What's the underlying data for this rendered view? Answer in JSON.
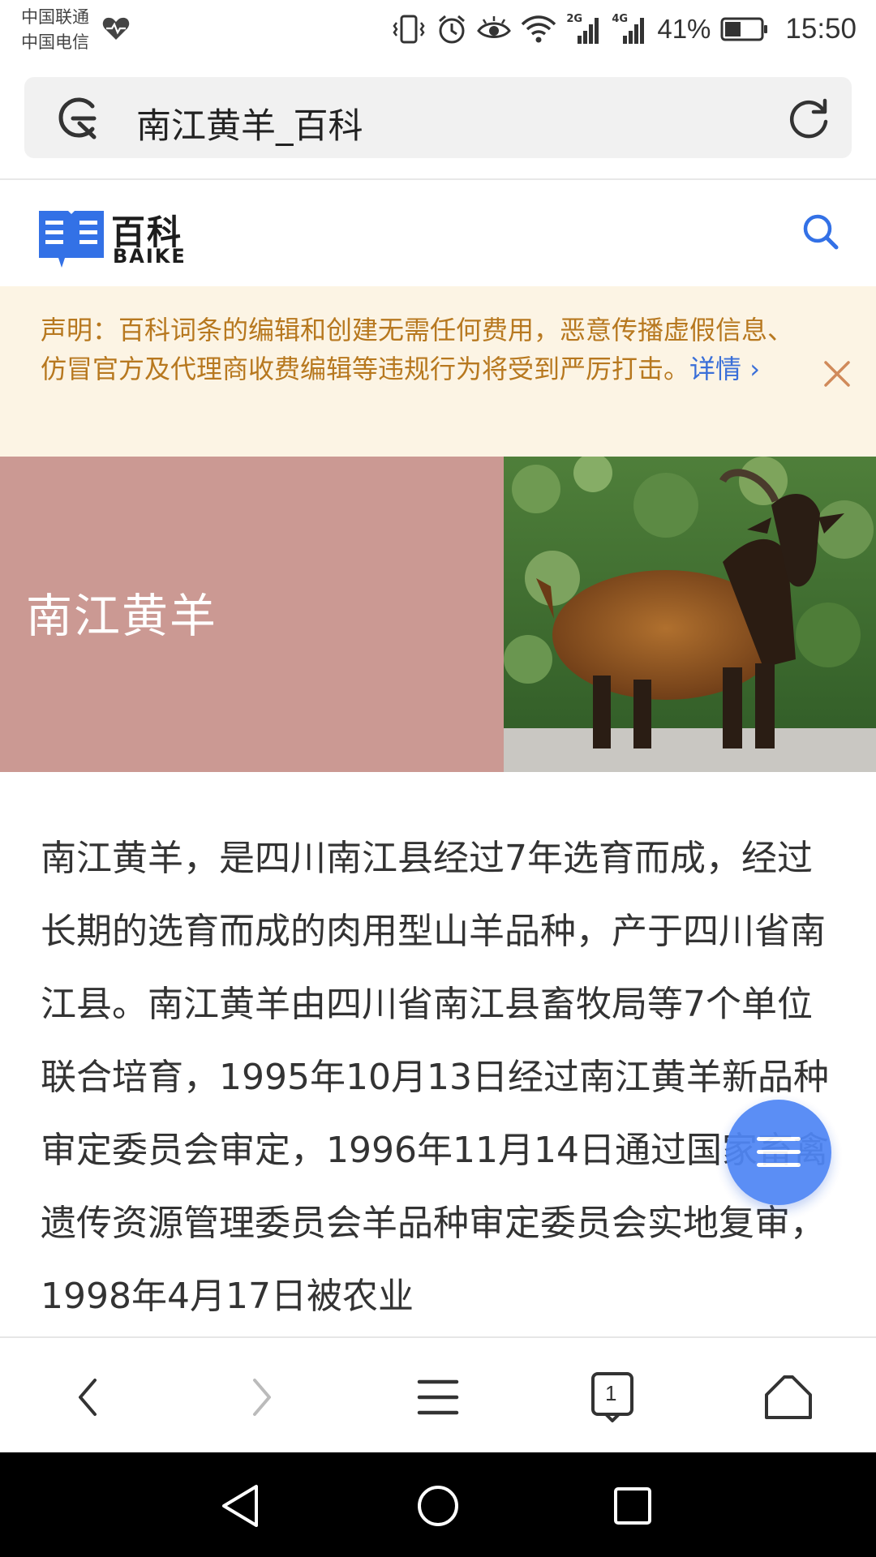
{
  "status_bar": {
    "carrier_1": "中国联通",
    "carrier_2": "中国电信",
    "network_1": "2G",
    "network_2": "4G",
    "battery": "41%",
    "time": "15:50",
    "icons": [
      "heart-monitor-icon",
      "vibrate-icon",
      "alarm-icon",
      "eye-comfort-icon",
      "wifi-icon",
      "signal-icon",
      "battery-icon"
    ]
  },
  "address_bar": {
    "title": "南江黄羊_百科"
  },
  "header": {
    "logo_cn": "百科",
    "logo_en": "BAIKE",
    "brand_color": "#3371e6"
  },
  "notice": {
    "text": "声明：百科词条的编辑和创建无需任何费用，恶意传播虚假信息、仿冒官方及代理商收费编辑等违规行为将受到严厉打击。",
    "link": "详情 ›"
  },
  "hero": {
    "title": "南江黄羊",
    "bg_color": "#cb9993"
  },
  "summary": {
    "text": "南江黄羊，是四川南江县经过7年选育而成，经过长期的选育而成的肉用型山羊品种，产于四川省南江县。南江黄羊由四川省南江县畜牧局等7个单位联合培育，1995年10月13日经过南江黄羊新品种审定委员会审定，1996年11月14日通过国家畜禽遗传资源管理委员会羊品种审定委员会实地复审，1998年4月17日被农业"
  },
  "bottom_bar": {
    "tab_count": "1"
  }
}
